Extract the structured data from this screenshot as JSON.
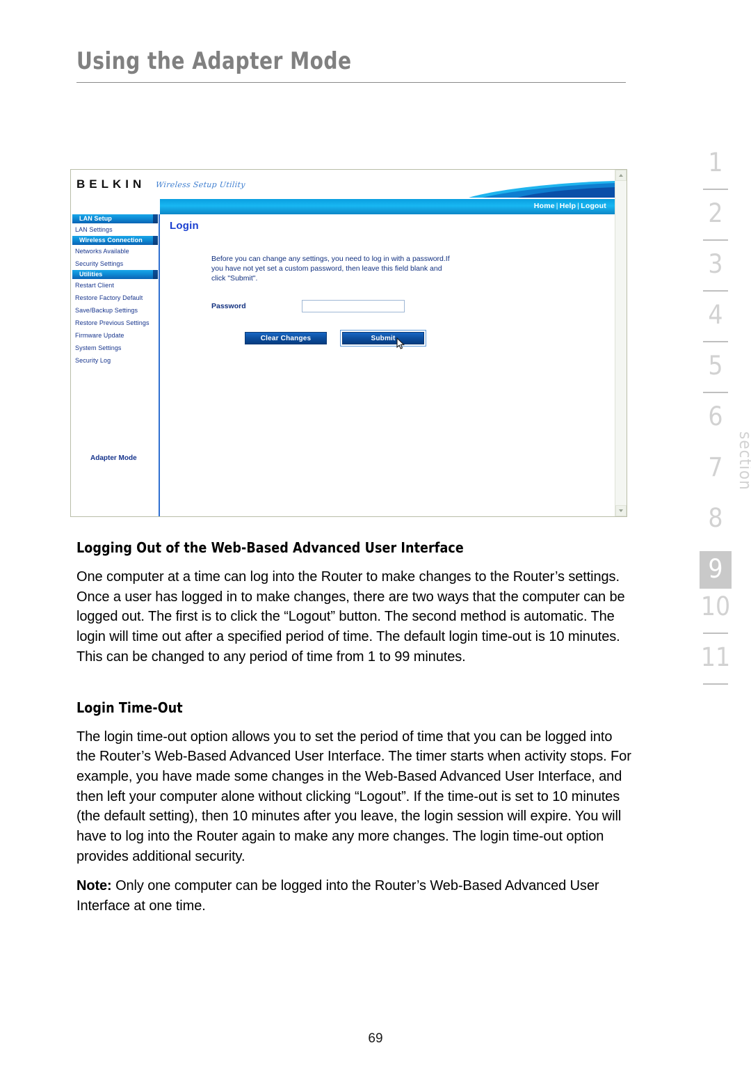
{
  "page": {
    "header_title": "Using the Adapter Mode",
    "page_number": "69"
  },
  "screenshot": {
    "brand": {
      "logo": "BELKIN",
      "tagline": "Wireless Setup Utility"
    },
    "nav": {
      "home": "Home",
      "separator": "|",
      "help": "Help",
      "logout": "Logout"
    },
    "sidebar": {
      "groups": [
        {
          "header": "LAN Setup",
          "items": [
            "LAN Settings"
          ]
        },
        {
          "header": "Wireless Connection",
          "items": [
            "Networks Available",
            "Security Settings"
          ]
        },
        {
          "header": "Utilities",
          "items": [
            "Restart Client",
            "Restore Factory Default",
            "Save/Backup Settings",
            "Restore Previous Settings",
            "Firmware Update",
            "System Settings",
            "Security Log"
          ]
        }
      ],
      "mode_label": "Adapter Mode"
    },
    "main": {
      "heading": "Login",
      "intro": "Before you can change any settings, you need to log in with a password.If you have not yet set a custom password, then leave this field blank and click \"Submit\".",
      "password_label": "Password",
      "password_value": "",
      "password_placeholder": "",
      "clear_button": "Clear Changes",
      "submit_button": "Submit"
    },
    "colors": {
      "nav_band": "#18b7f2",
      "menu_header": "#0f8fd8",
      "link_text": "#16348c",
      "heading": "#1a3fd0",
      "button": "#0c4e9e"
    }
  },
  "content": {
    "heading_1": "Logging Out of the Web-Based Advanced User Interface",
    "paragraph_1": "One computer at a time can log into the Router to make changes to the Router’s settings. Once a user has logged in to make changes, there are two ways that the computer can be logged out. The first is to click the “Logout” button. The second method is automatic. The login will time out after a specified period of time. The default login time-out is 10 minutes. This can be changed to any period of time from 1 to 99 minutes.",
    "heading_2": "Login Time-Out",
    "paragraph_2": "The login time-out option allows you to set the period of time that you can be logged into the Router’s Web-Based Advanced User Interface. The timer starts when activity stops. For example, you have made some changes in the Web-Based Advanced User Interface, and then left your computer alone without clicking “Logout”. If the time-out is set to 10 minutes (the default setting), then 10 minutes after you leave, the login session will expire. You will have to log into the Router again to make any more changes. The login time-out option provides additional security.",
    "note_label": "Note:",
    "note_text": " Only one computer can be logged into the Router’s Web-Based Advanced User Interface at one time."
  },
  "section_tabs": {
    "numbers": [
      "1",
      "2",
      "3",
      "4",
      "5",
      "6",
      "7",
      "8",
      "9",
      "10",
      "11"
    ],
    "active": "9",
    "word": "section"
  }
}
